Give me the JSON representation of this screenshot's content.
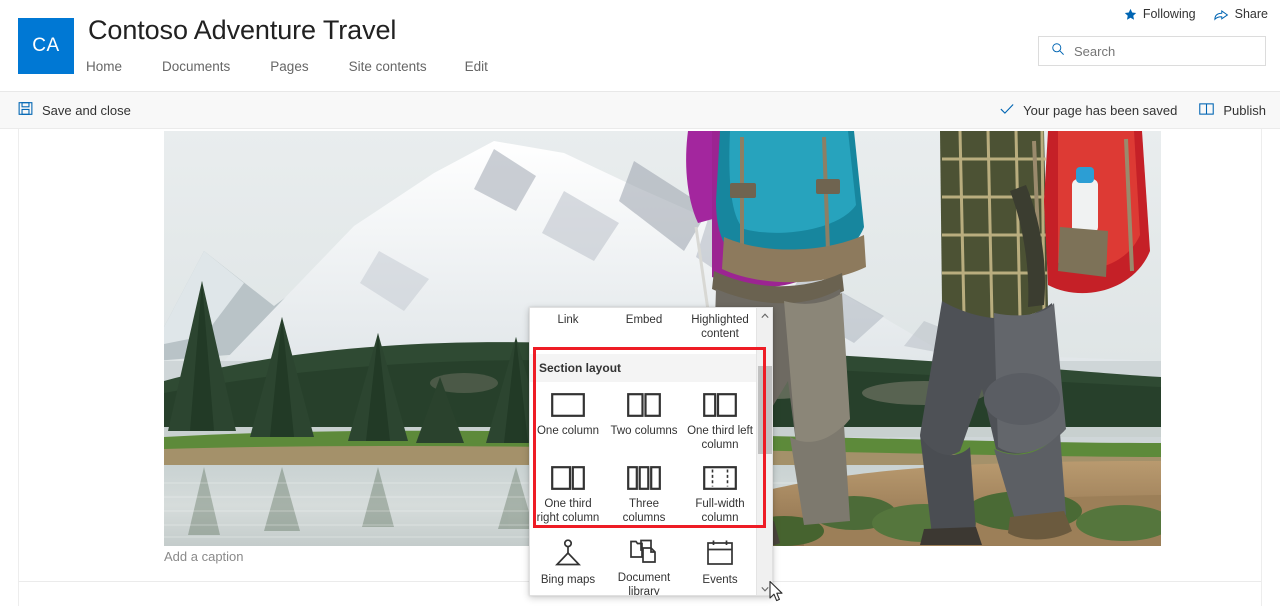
{
  "header": {
    "logo_initials": "CA",
    "logo_color": "#0078d4",
    "title": "Contoso Adventure Travel",
    "nav": [
      {
        "label": "Home"
      },
      {
        "label": "Documents"
      },
      {
        "label": "Pages"
      },
      {
        "label": "Site contents"
      },
      {
        "label": "Edit"
      }
    ],
    "following_label": "Following",
    "share_label": "Share",
    "search": {
      "value": "",
      "placeholder": "Search"
    }
  },
  "command_bar": {
    "save_and_close_label": "Save and close",
    "save_status": "Your page has been saved",
    "publish_label": "Publish"
  },
  "canvas": {
    "caption_placeholder": "Add a caption"
  },
  "picker": {
    "top_webparts": [
      {
        "label": "Link"
      },
      {
        "label": "Embed"
      },
      {
        "label": "Highlighted content"
      }
    ],
    "section_layout_header": "Section layout",
    "layouts": [
      {
        "label": "One column",
        "icon": "one-column-icon"
      },
      {
        "label": "Two columns",
        "icon": "two-columns-icon"
      },
      {
        "label": "One third left column",
        "icon": "one-third-left-column-icon"
      },
      {
        "label": "One third right column",
        "icon": "one-third-right-column-icon"
      },
      {
        "label": "Three columns",
        "icon": "three-columns-icon"
      },
      {
        "label": "Full-width column",
        "icon": "full-width-column-icon"
      }
    ],
    "bottom_webparts": [
      {
        "label": "Bing maps",
        "icon": "bing-maps-icon"
      },
      {
        "label": "Document library",
        "icon": "document-library-icon"
      },
      {
        "label": "Events",
        "icon": "events-icon"
      }
    ],
    "highlight_color": "#ee1c25"
  }
}
